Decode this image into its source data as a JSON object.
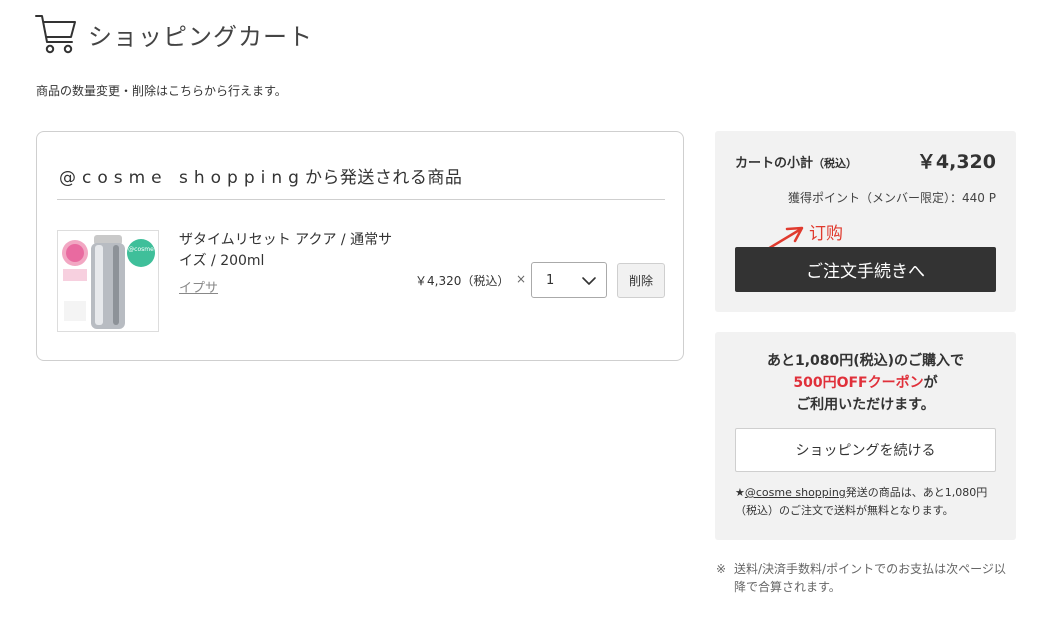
{
  "header": {
    "title": "ショッピングカート",
    "cart_icon": "shopping-cart-icon"
  },
  "intro": "商品の数量変更・削除はこちらから行えます。",
  "shipper_box": {
    "title_brand": "@cosme shopping",
    "title_suffix": "から発送される商品",
    "items": [
      {
        "name": "ザタイムリセット アクア / 通常サイズ / 200ml",
        "brand": "イプサ",
        "price": "￥4,320（税込）",
        "times": "×",
        "quantity": "1",
        "delete_label": "削除",
        "thumb_badge": "@cosme"
      }
    ]
  },
  "summary": {
    "subtotal_label": "カートの小計",
    "subtotal_tax": "（税込）",
    "subtotal_amount": "￥4,320",
    "points_note": "獲得ポイント（メンバー限定）：440 P",
    "annotation": "订购",
    "checkout_label": "ご注文手続きへ"
  },
  "coupon": {
    "line1": "あと1,080円(税込)のご購入で",
    "line2": "500円OFFクーポン",
    "line2_suffix": "が",
    "line3": "ご利用いただけます。",
    "continue_label": "ショッピングを続ける",
    "note_star": "★",
    "note_link": "@cosme shopping",
    "note_text": "発送の商品は、あと1,080円（税込）のご注文で送料が無料となります。"
  },
  "footnote": {
    "mark": "※",
    "text": "送料/決済手数料/ポイントでのお支払は次ページ以降で合算されます。"
  },
  "colors": {
    "accent_red": "#e0303a",
    "annotation_red": "#e03a2e",
    "checkout_bg": "#333333",
    "panel_bg": "#f2f2f2"
  }
}
